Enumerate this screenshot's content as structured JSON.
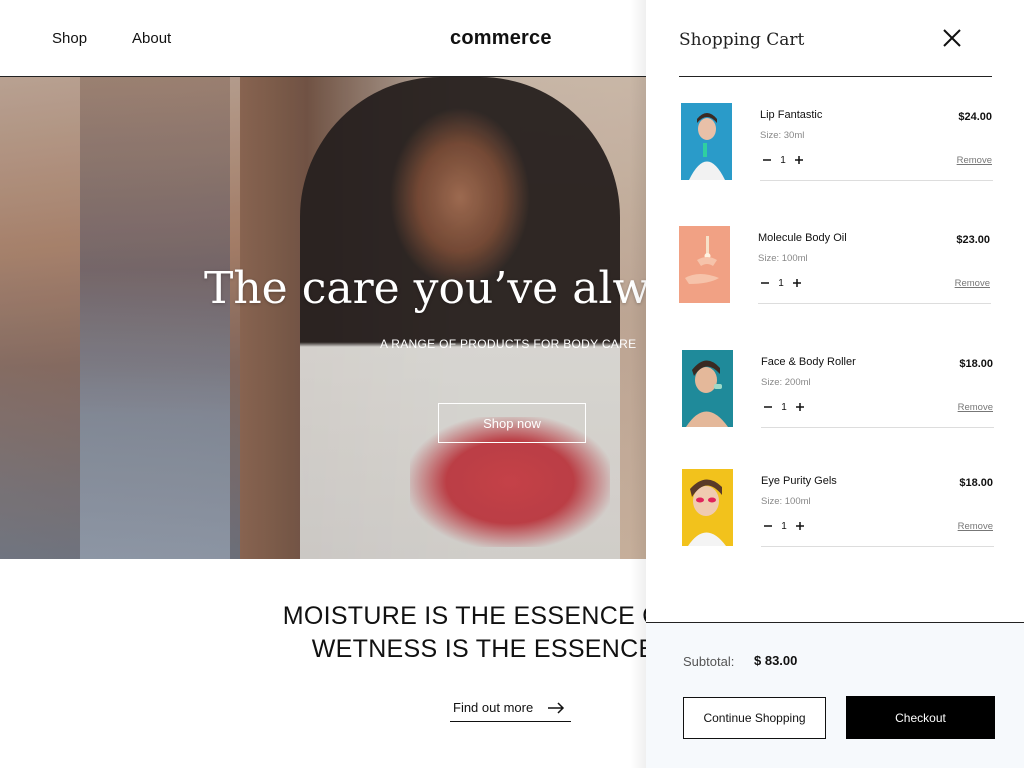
{
  "header": {
    "nav": [
      {
        "label": "Shop"
      },
      {
        "label": "About"
      }
    ],
    "logo": "commerce"
  },
  "hero": {
    "title": "The care you’ve always",
    "subtitle": "A RANGE OF PRODUCTS FOR BODY CARE",
    "cta": "Shop now"
  },
  "tagline": {
    "line1": "MOISTURE IS THE ESSENCE OF WET",
    "line2": "WETNESS IS THE ESSENCE OF B",
    "link": "Find out more"
  },
  "cart": {
    "title": "Shopping Cart",
    "remove_label": "Remove",
    "items": [
      {
        "name": "Lip Fantastic",
        "size": "Size: 30ml",
        "qty": "1",
        "price": "$24.00",
        "thumb_color": "#2a9bc9"
      },
      {
        "name": "Molecule Body Oil",
        "size": "Size: 100ml",
        "qty": "1",
        "price": "$23.00",
        "thumb_color": "#f1a184"
      },
      {
        "name": "Face & Body Roller",
        "size": "Size: 200ml",
        "qty": "1",
        "price": "$18.00",
        "thumb_color": "#1f8a9a"
      },
      {
        "name": "Eye Purity Gels",
        "size": "Size: 100ml",
        "qty": "1",
        "price": "$18.00",
        "thumb_color": "#f2c21c"
      }
    ],
    "subtotal_label": "Subtotal:",
    "subtotal_value": "$ 83.00",
    "continue_label": "Continue Shopping",
    "checkout_label": "Checkout"
  },
  "colors": {
    "footer_bg": "#f6f9fc",
    "checkout_bg": "#000000"
  }
}
